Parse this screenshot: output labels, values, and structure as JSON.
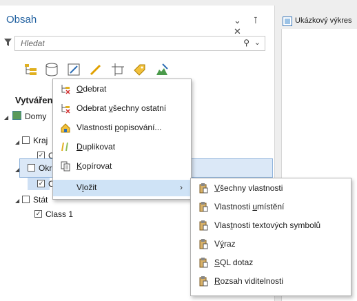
{
  "pane": {
    "title": "Obsah",
    "controls": "⌄ ⊺ ✕",
    "search_placeholder": "Hledat",
    "drawing_label": "Vytvářen"
  },
  "tree": {
    "domy": "Domy",
    "kraj": "Kraj",
    "c1": "C",
    "okr": "Okr",
    "c2": "C",
    "stat": "Stát",
    "class1": "Class 1"
  },
  "map_tab": {
    "label": "Ukázkový výkres"
  },
  "menu1": {
    "items": [
      {
        "pre": "",
        "u": "O",
        "post": "debrat"
      },
      {
        "pre": "Odebrat ",
        "u": "v",
        "post": "šechny ostatní"
      },
      {
        "pre": "Vlastnosti ",
        "u": "p",
        "post": "opisování..."
      },
      {
        "pre": "",
        "u": "D",
        "post": "uplikovat"
      },
      {
        "pre": "",
        "u": "K",
        "post": "opírovat"
      },
      {
        "pre": "V",
        "u": "l",
        "post": "ožit"
      }
    ]
  },
  "menu2": {
    "items": [
      {
        "pre": "",
        "u": "V",
        "post": "šechny vlastnosti"
      },
      {
        "pre": "Vlastnosti ",
        "u": "u",
        "post": "místění"
      },
      {
        "pre": "Vlas",
        "u": "t",
        "post": "nosti textových symbolů"
      },
      {
        "pre": "V",
        "u": "ý",
        "post": "raz"
      },
      {
        "pre": "",
        "u": "S",
        "post": "QL dotaz"
      },
      {
        "pre": "",
        "u": "R",
        "post": "ozsah viditelnosti"
      }
    ]
  },
  "colors": {
    "accent": "#2f6fb5",
    "highlight": "#cfe3f6",
    "title": "#1f5f9f"
  }
}
